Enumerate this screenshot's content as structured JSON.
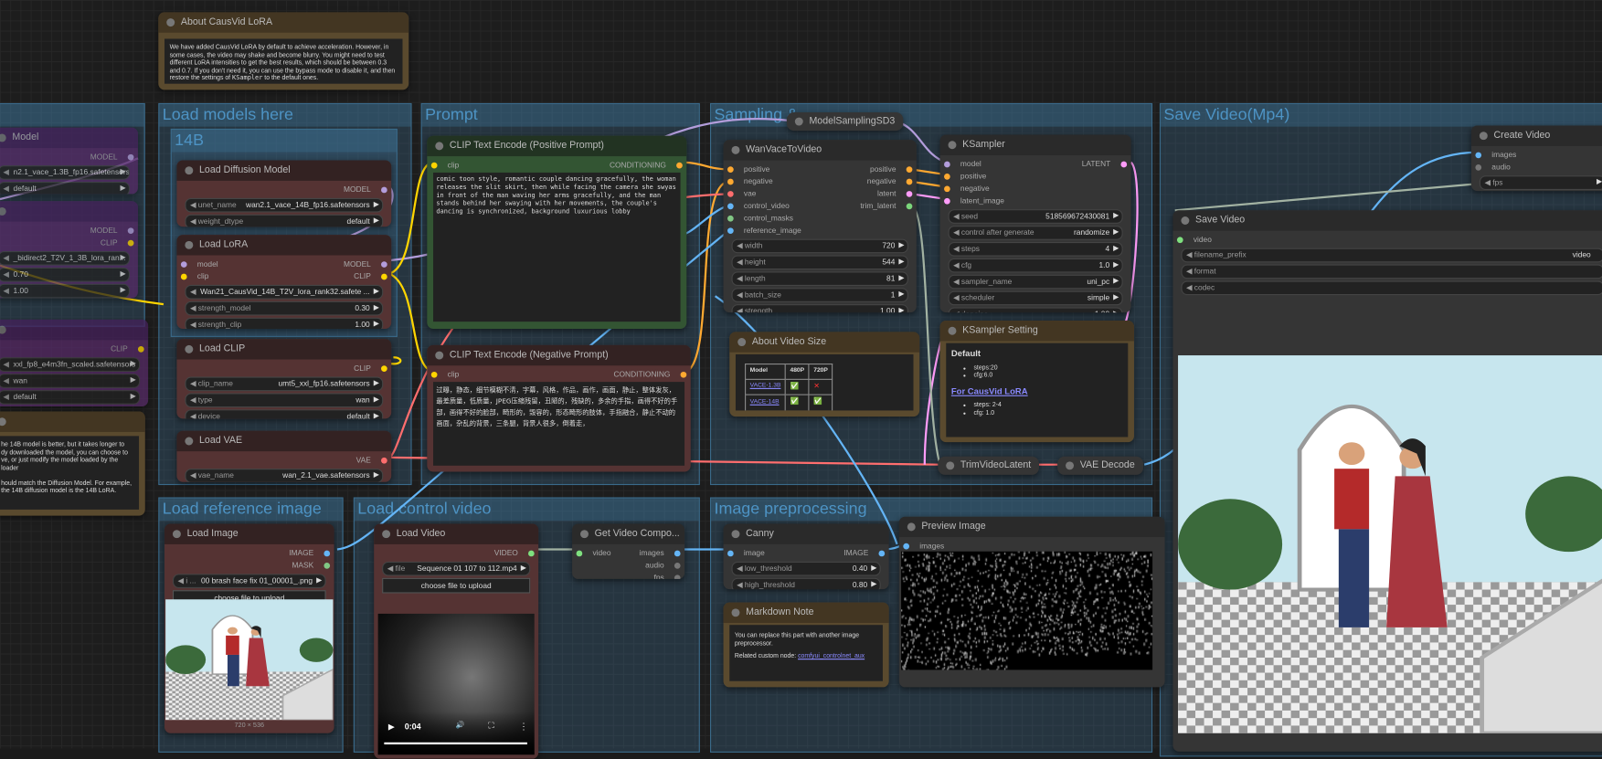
{
  "wire_colors": {
    "MODEL": "#b39ddb",
    "CLIP": "#ffd500",
    "CONDITIONING": "#ffa931",
    "VAE": "#ff6e6e",
    "IMAGE": "#64b5f6",
    "LATENT": "#ff9cf9",
    "VIDEO": "#a3b3a3",
    "MASK": "#81c784"
  },
  "groups": {
    "left": "",
    "models": "Load models here",
    "b14": "14B",
    "prompt": "Prompt",
    "sampling": "Sampling &",
    "save": "Save Video(Mp4)",
    "refimg": "Load reference image",
    "ctrlvid": "Load control video",
    "preproc": "Image preprocessing"
  },
  "nodes": {
    "p_model": {
      "title": "Model",
      "rows": [
        [
          "",
          "MODEL"
        ]
      ],
      "widgets": [
        [
          "",
          "n2.1_vace_1.3B_fp16.safetensors"
        ],
        [
          "",
          "default"
        ]
      ]
    },
    "p_lora": {
      "title": "",
      "rows": [
        [
          "",
          "MODEL"
        ],
        [
          "",
          "CLIP"
        ]
      ],
      "widgets": [
        [
          "",
          "_bidirect2_T2V_1_3B_lora_ran..."
        ],
        [
          "",
          "0.70"
        ],
        [
          "",
          "1.00"
        ]
      ]
    },
    "p_clip": {
      "title": "",
      "rows": [
        [
          "",
          "CLIP"
        ]
      ],
      "widgets": [
        [
          "",
          "xxl_fp8_e4m3fn_scaled.safetensors"
        ],
        [
          "",
          "wan"
        ],
        [
          "",
          "default"
        ]
      ]
    },
    "diff": {
      "title": "Load Diffusion Model",
      "rows": [
        [
          "",
          "MODEL"
        ]
      ],
      "widgets": [
        [
          "unet_name",
          "wan2.1_vace_14B_fp16.safetensors"
        ],
        [
          "weight_dtype",
          "default"
        ]
      ]
    },
    "lora": {
      "title": "Load LoRA",
      "rows": [
        [
          "model",
          "MODEL"
        ],
        [
          "clip",
          "CLIP"
        ]
      ],
      "widgets": [
        [
          "",
          "Wan21_CausVid_14B_T2V_lora_rank32.safete ..."
        ],
        [
          "strength_model",
          "0.30"
        ],
        [
          "strength_clip",
          "1.00"
        ]
      ]
    },
    "clip": {
      "title": "Load CLIP",
      "rows": [
        [
          "",
          "CLIP"
        ]
      ],
      "widgets": [
        [
          "clip_name",
          "umt5_xxl_fp16.safetensors"
        ],
        [
          "type",
          "wan"
        ],
        [
          "device",
          "default"
        ]
      ]
    },
    "vae": {
      "title": "Load VAE",
      "rows": [
        [
          "",
          "VAE"
        ]
      ],
      "widgets": [
        [
          "vae_name",
          "wan_2.1_vae.safetensors"
        ]
      ]
    },
    "pos": {
      "title": "CLIP Text Encode (Positive Prompt)",
      "rows": [
        [
          "clip",
          "CONDITIONING"
        ]
      ],
      "widgets": [],
      "text": "comic toon style, romantic couple dancing gracefully, the woman releases the slit skirt, then while facing the camera she swyas in front of the man waving her arms gracefully, and the man stands behind her swaying with her movements, the couple's dancing is synchronized, background luxurious lobby"
    },
    "neg": {
      "title": "CLIP Text Encode (Negative Prompt)",
      "rows": [
        [
          "clip",
          "CONDITIONING"
        ]
      ],
      "widgets": [],
      "text": "过曝，静态，细节模糊不清，字幕，风格，作品，画作，画面，静止，整体发灰，最差质量，低质量，JPEG压缩残留，丑陋的，残缺的，多余的手指，画得不好的手部，画得不好的脸部，畸形的，毁容的，形态畸形的肢体，手指融合，静止不动的画面，杂乱的背景，三条腿，背景人很多，倒着走，"
    },
    "wan": {
      "title": "WanVaceToVideo",
      "rows": [
        [
          "positive",
          "positive"
        ],
        [
          "negative",
          "negative"
        ],
        [
          "vae",
          "latent"
        ],
        [
          "control_video",
          "trim_latent"
        ],
        [
          "control_masks",
          ""
        ],
        [
          "reference_image",
          ""
        ]
      ],
      "widgets": [
        [
          "width",
          "720"
        ],
        [
          "height",
          "544"
        ],
        [
          "length",
          "81"
        ],
        [
          "batch_size",
          "1"
        ],
        [
          "strength",
          "1.00"
        ]
      ]
    },
    "ks": {
      "title": "KSampler",
      "rows": [
        [
          "model",
          "LATENT"
        ],
        [
          "positive",
          ""
        ],
        [
          "negative",
          ""
        ],
        [
          "latent_image",
          ""
        ]
      ],
      "widgets": [
        [
          "seed",
          "518569672430081"
        ],
        [
          "control after generate",
          "randomize"
        ],
        [
          "steps",
          "4"
        ],
        [
          "cfg",
          "1.0"
        ],
        [
          "sampler_name",
          "uni_pc"
        ],
        [
          "scheduler",
          "simple"
        ],
        [
          "denoise",
          "1.00"
        ]
      ]
    },
    "cvid": {
      "title": "Create Video",
      "rows": [
        [
          "images",
          ""
        ],
        [
          "audio",
          ""
        ]
      ],
      "widgets": [
        [
          "fps",
          ""
        ]
      ]
    },
    "svid": {
      "title": "Save Video",
      "rows": [
        [
          "video",
          ""
        ]
      ],
      "widgets": [
        [
          "filename_prefix",
          "video"
        ],
        [
          "format",
          ""
        ],
        [
          "codec",
          ""
        ]
      ]
    },
    "limg": {
      "title": "Load Image",
      "rows": [
        [
          "",
          "IMAGE"
        ],
        [
          "",
          "MASK"
        ]
      ],
      "widgets": [
        [
          "i ...",
          "00 brash face fix 01_00001_.png"
        ]
      ],
      "button": "choose file to upload",
      "size": "720 × 536"
    },
    "lvid": {
      "title": "Load Video",
      "rows": [
        [
          "",
          "VIDEO"
        ]
      ],
      "widgets": [
        [
          "file",
          "Sequence 01 107 to 112.mp4"
        ]
      ],
      "button": "choose file to upload",
      "time": "0:04"
    },
    "gvc": {
      "title": "Get Video Compo...",
      "rows": [
        [
          "video",
          "images"
        ],
        [
          "",
          "audio"
        ],
        [
          "",
          "fps"
        ]
      ],
      "widgets": []
    },
    "canny": {
      "title": "Canny",
      "rows": [
        [
          "image",
          "IMAGE"
        ]
      ],
      "widgets": [
        [
          "low_threshold",
          "0.40"
        ],
        [
          "high_threshold",
          "0.80"
        ]
      ]
    },
    "prev": {
      "title": "Preview Image",
      "rows": [
        [
          "images",
          ""
        ]
      ],
      "widgets": []
    }
  },
  "collapsed": {
    "msd3": "ModelSamplingSD3",
    "trim": "TrimVideoLatent",
    "vaedec": "VAE Decode"
  },
  "notes": {
    "about": {
      "title": "About CausVid LoRA",
      "pre": "We have added CausVid LoRA by default to achieve acceleration. However, in some cases, the video may shake and become blurry. You might need to test different LoRA intensities to get the best results, which should be between 0.3 and 0.7. If you don't need it, you can use the bypass mode to disable it, and then restore the settings of ",
      "code": "KSampler",
      "post": " to the default ones."
    },
    "left": {
      "title": "",
      "lines": [
        "he 14B model is better, but it takes longer to",
        "dy downloaded the model, you can choose to",
        "ve, or just modify the model loaded by the loader",
        "",
        "hould match the Diffusion Model. For example,",
        "the 14B diffusion model is the 14B LoRA."
      ]
    },
    "vsize": {
      "title": "About Video Size",
      "head": [
        "Model",
        "480P",
        "720P"
      ],
      "rows": [
        [
          "VACE-1.3B",
          "ok",
          "no"
        ],
        [
          "VACE-14B",
          "ok",
          "ok"
        ]
      ]
    },
    "kset": {
      "title": "KSampler Setting",
      "h1": "Default",
      "l1": [
        "steps:20",
        "cfg:6.0"
      ],
      "h2": "For CausVid LoRA",
      "l2": [
        "steps: 2-4",
        "cfg: 1.0"
      ]
    },
    "md": {
      "title": "Markdown Note",
      "p1": "You can replace this part with another image preprocessor.",
      "p2": "Related custom node: ",
      "link": "comfyui_controlnet_aux"
    }
  }
}
